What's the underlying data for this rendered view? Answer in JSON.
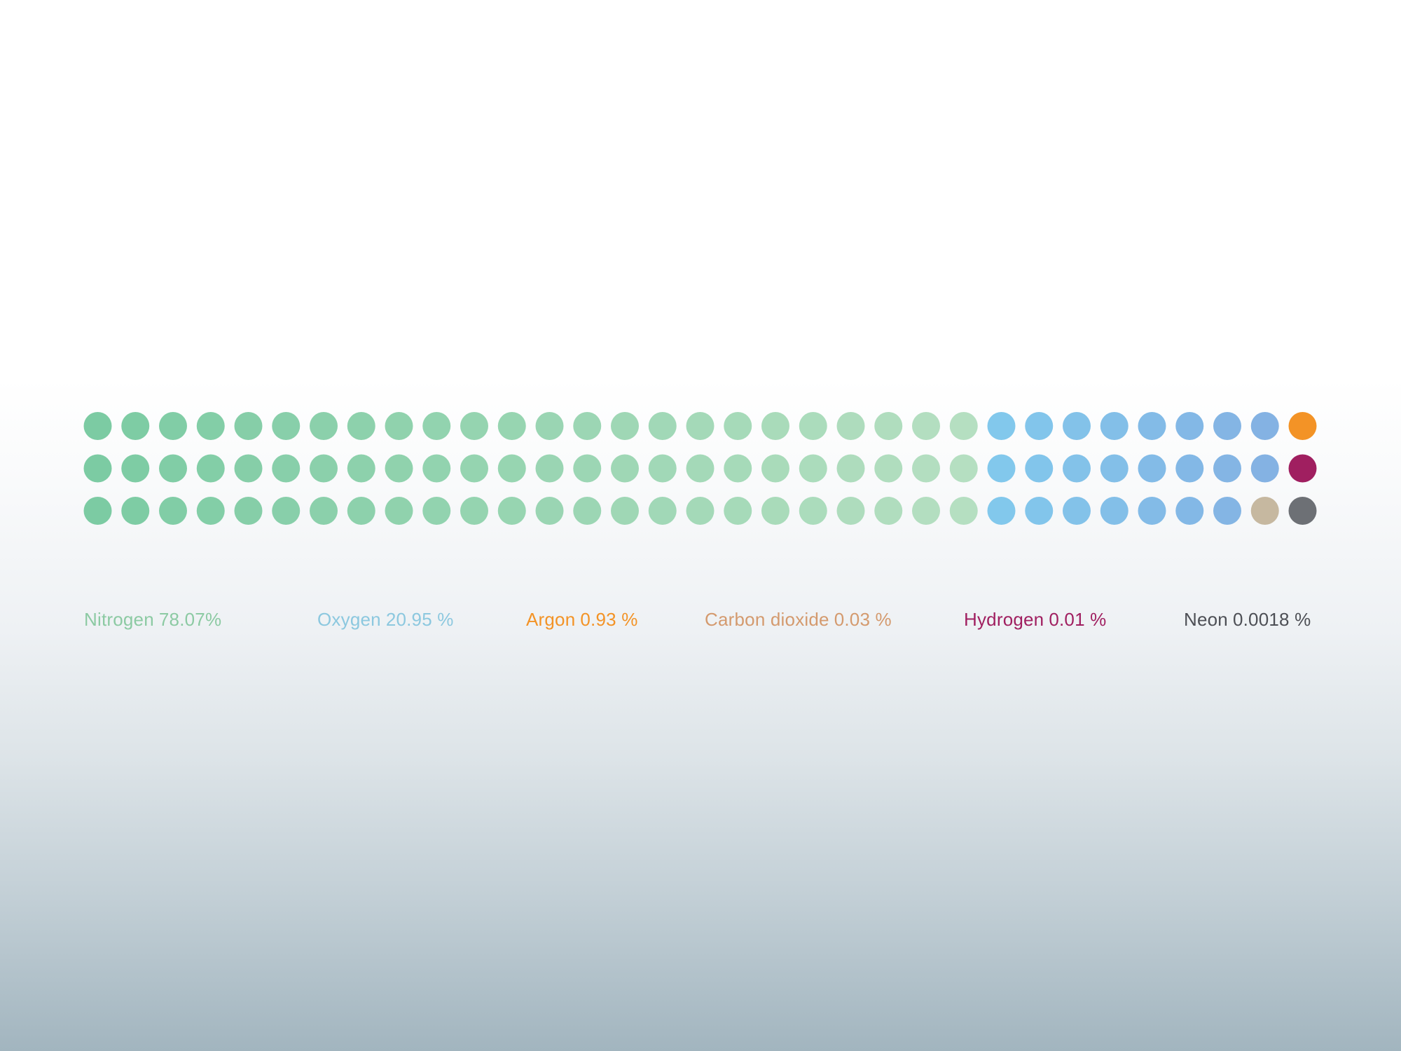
{
  "chart_data": {
    "type": "waffle",
    "title": "",
    "grid": {
      "rows": 3,
      "columns": 33
    },
    "fill_order": "column-major, left to right, top to bottom",
    "series": [
      {
        "name": "Nitrogen",
        "value_label": "78.07%",
        "value": 78.07,
        "dots": 72,
        "color_start": "#7ccba3",
        "color_end": "#b5dfc1"
      },
      {
        "name": "Oxygen",
        "value_label": "20.95 %",
        "value": 20.95,
        "dots": 23,
        "color_start": "#82c8ec",
        "color_end": "#84b2e3"
      },
      {
        "name": "Argon",
        "value_label": "0.93 %",
        "value": 0.93,
        "dots": 1,
        "color": "#f39326"
      },
      {
        "name": "Carbon dioxide",
        "value_label": "0.03 %",
        "value": 0.03,
        "dots": 1,
        "color": "#c6b8a0"
      },
      {
        "name": "Hydrogen",
        "value_label": "0.01 %",
        "value": 0.01,
        "dots": 1,
        "color": "#a01f60"
      },
      {
        "name": "Neon",
        "value_label": "0.0018 %",
        "value": 0.0018,
        "dots": 1,
        "color": "#6d7075"
      }
    ],
    "legend_colors": {
      "Nitrogen": "#8ccaa3",
      "Oxygen": "#8cc8df",
      "Argon": "#f39326",
      "Carbon dioxide": "#d49a6e",
      "Hydrogen": "#a01f60",
      "Neon": "#4d4f55"
    },
    "legend_position": "bottom"
  }
}
